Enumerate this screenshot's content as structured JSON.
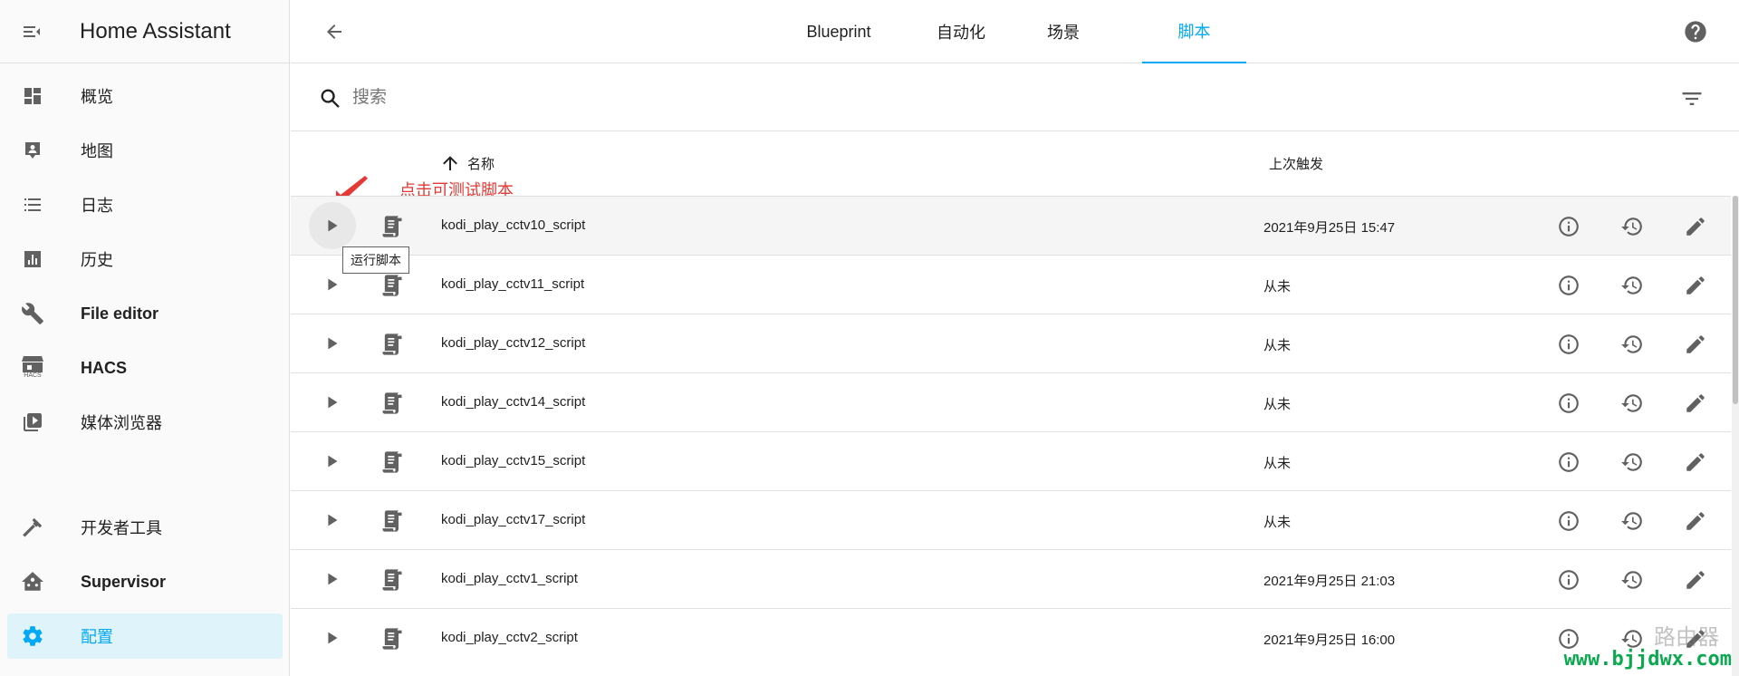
{
  "sidebar": {
    "title": "Home Assistant",
    "items": [
      {
        "label": "概览",
        "icon": "dashboard-icon",
        "bold": false
      },
      {
        "label": "地图",
        "icon": "map-account-icon",
        "bold": false
      },
      {
        "label": "日志",
        "icon": "format-list-icon",
        "bold": false
      },
      {
        "label": "历史",
        "icon": "chart-box-icon",
        "bold": false
      },
      {
        "label": "File editor",
        "icon": "wrench-icon",
        "bold": true
      },
      {
        "label": "HACS",
        "icon": "hacs-store-icon",
        "bold": true
      },
      {
        "label": "媒体浏览器",
        "icon": "play-box-multiple-icon",
        "bold": false
      }
    ],
    "bottom_items": [
      {
        "label": "开发者工具",
        "icon": "hammer-icon",
        "bold": false
      },
      {
        "label": "Supervisor",
        "icon": "home-assistant-icon",
        "bold": true
      },
      {
        "label": "配置",
        "icon": "cog-icon",
        "bold": false,
        "selected": true
      }
    ],
    "hacs_icon_text": "HACS"
  },
  "topbar": {
    "tabs": [
      "Blueprint",
      "自动化",
      "场景",
      "脚本"
    ],
    "active_tab": "脚本"
  },
  "search": {
    "placeholder": "搜索",
    "value": ""
  },
  "table": {
    "columns": {
      "name": "名称",
      "last_triggered": "上次触发"
    },
    "annotation": "点击可测试脚本",
    "tooltip": "运行脚本",
    "rows": [
      {
        "name": "kodi_play_cctv10_script",
        "last": "2021年9月25日 15:47"
      },
      {
        "name": "kodi_play_cctv11_script",
        "last": "从未"
      },
      {
        "name": "kodi_play_cctv12_script",
        "last": "从未"
      },
      {
        "name": "kodi_play_cctv14_script",
        "last": "从未"
      },
      {
        "name": "kodi_play_cctv15_script",
        "last": "从未"
      },
      {
        "name": "kodi_play_cctv17_script",
        "last": "从未"
      },
      {
        "name": "kodi_play_cctv1_script",
        "last": "2021年9月25日 21:03"
      },
      {
        "name": "kodi_play_cctv2_script",
        "last": "2021年9月25日 16:00"
      }
    ]
  },
  "colors": {
    "accent": "#03a9f4",
    "icon": "#616161",
    "annotation": "#e53935"
  },
  "watermark": {
    "url": "www.bjjdwx.com",
    "logo": "路由器"
  }
}
